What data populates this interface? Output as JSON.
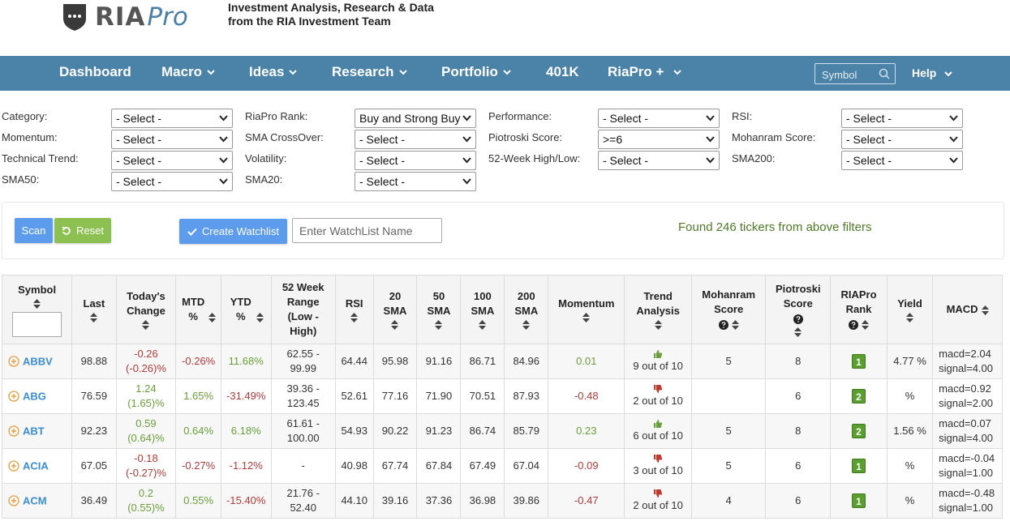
{
  "header": {
    "logo_ria": "RIA",
    "logo_pro": "Pro",
    "tagline_line1": "Investment Analysis, Research & Data",
    "tagline_line2": "from the RIA Investment Team"
  },
  "nav": {
    "items": [
      {
        "label": "Dashboard",
        "dropdown": false
      },
      {
        "label": "Macro",
        "dropdown": true
      },
      {
        "label": "Ideas",
        "dropdown": true
      },
      {
        "label": "Research",
        "dropdown": true
      },
      {
        "label": "Portfolio",
        "dropdown": true
      },
      {
        "label": "401K",
        "dropdown": false
      },
      {
        "label": "RiaPro +",
        "dropdown": true
      }
    ],
    "symbol_placeholder": "Symbol",
    "help_label": "Help"
  },
  "filters": {
    "category": {
      "label": "Category:",
      "value": "- Select -"
    },
    "momentum": {
      "label": "Momentum:",
      "value": "- Select -"
    },
    "technical_trend": {
      "label": "Technical Trend:",
      "value": "- Select -"
    },
    "sma50": {
      "label": "SMA50:",
      "value": "- Select -"
    },
    "riapro_rank": {
      "label": "RiaPro Rank:",
      "value": "Buy and Strong Buy"
    },
    "sma_crossover": {
      "label": "SMA CrossOver:",
      "value": "- Select -"
    },
    "volatility": {
      "label": "Volatility:",
      "value": "- Select -"
    },
    "sma20": {
      "label": "SMA20:",
      "value": "- Select -"
    },
    "performance": {
      "label": "Performance:",
      "value": "- Select -"
    },
    "piotroski": {
      "label": "Piotroski Score:",
      "value": ">=6"
    },
    "week52": {
      "label": "52-Week High/Low:",
      "value": "- Select -"
    },
    "rsi": {
      "label": "RSI:",
      "value": "- Select -"
    },
    "mohanram": {
      "label": "Mohanram Score:",
      "value": "- Select -"
    },
    "sma200": {
      "label": "SMA200:",
      "value": "- Select -"
    }
  },
  "actions": {
    "scan_label": "Scan",
    "reset_label": "Reset",
    "watchlist_label": "Create Watchlist",
    "watchlist_placeholder": "Enter WatchList Name",
    "found_text": "Found 246 tickers from above filters"
  },
  "table": {
    "headers": {
      "symbol": "Symbol",
      "last": "Last",
      "todays_change": "Today's Change",
      "mtd": "MTD %",
      "ytd": "YTD %",
      "week52": "52 Week Range (Low - High)",
      "rsi": "RSI",
      "sma20": "20 SMA",
      "sma50": "50 SMA",
      "sma100": "100 SMA",
      "sma200": "200 SMA",
      "momentum": "Momentum",
      "trend": "Trend Analysis",
      "mohanram": "Mohanram Score",
      "piotroski": "Piotroski Score",
      "rank": "RIAPro Rank",
      "yield": "Yield",
      "macd": "MACD"
    },
    "rows": [
      {
        "symbol": "ABBV",
        "last": "98.88",
        "chg1": "-0.26",
        "chg2": "(-0.26)%",
        "chg_dir": "neg",
        "mtd": "-0.26%",
        "mtd_dir": "neg",
        "ytd": "11.68%",
        "ytd_dir": "pos",
        "r1": "62.55 -",
        "r2": "99.99",
        "rsi": "64.44",
        "sma20": "95.98",
        "sma50": "91.16",
        "sma100": "86.71",
        "sma200": "84.96",
        "momentum": "0.01",
        "mom_dir": "pos",
        "trend_icon": "thumbs-up",
        "trend": "9 out of 10",
        "mohanram": "5",
        "piotroski": "8",
        "rank": "1",
        "yield": "4.77 %",
        "macd1": "macd=2.04",
        "macd2": "signal=4.00"
      },
      {
        "symbol": "ABG",
        "last": "76.59",
        "chg1": "1.24",
        "chg2": "(1.65)%",
        "chg_dir": "pos",
        "mtd": "1.65%",
        "mtd_dir": "pos",
        "ytd": "-31.49%",
        "ytd_dir": "neg",
        "r1": "39.36 -",
        "r2": "123.45",
        "rsi": "52.61",
        "sma20": "77.16",
        "sma50": "71.90",
        "sma100": "70.51",
        "sma200": "87.93",
        "momentum": "-0.48",
        "mom_dir": "neg",
        "trend_icon": "thumbs-down",
        "trend": "2 out of 10",
        "mohanram": "",
        "piotroski": "6",
        "rank": "2",
        "yield": "%",
        "macd1": "macd=0.92",
        "macd2": "signal=2.00"
      },
      {
        "symbol": "ABT",
        "last": "92.23",
        "chg1": "0.59",
        "chg2": "(0.64)%",
        "chg_dir": "pos",
        "mtd": "0.64%",
        "mtd_dir": "pos",
        "ytd": "6.18%",
        "ytd_dir": "pos",
        "r1": "61.61 -",
        "r2": "100.00",
        "rsi": "54.93",
        "sma20": "90.22",
        "sma50": "91.23",
        "sma100": "86.74",
        "sma200": "85.79",
        "momentum": "0.23",
        "mom_dir": "pos",
        "trend_icon": "thumbs-up",
        "trend": "6 out of 10",
        "mohanram": "5",
        "piotroski": "8",
        "rank": "2",
        "yield": "1.56 %",
        "macd1": "macd=0.07",
        "macd2": "signal=4.00"
      },
      {
        "symbol": "ACIA",
        "last": "67.05",
        "chg1": "-0.18",
        "chg2": "(-0.27)%",
        "chg_dir": "neg",
        "mtd": "-0.27%",
        "mtd_dir": "neg",
        "ytd": "-1.12%",
        "ytd_dir": "neg",
        "r1": "-",
        "r2": "",
        "rsi": "40.98",
        "sma20": "67.74",
        "sma50": "67.84",
        "sma100": "67.49",
        "sma200": "67.04",
        "momentum": "-0.09",
        "mom_dir": "neg",
        "trend_icon": "thumbs-down",
        "trend": "3 out of 10",
        "mohanram": "5",
        "piotroski": "6",
        "rank": "1",
        "yield": "%",
        "macd1": "macd=-0.04",
        "macd2": "signal=1.00"
      },
      {
        "symbol": "ACM",
        "last": "36.49",
        "chg1": "0.2",
        "chg2": "(0.55)%",
        "chg_dir": "pos",
        "mtd": "0.55%",
        "mtd_dir": "pos",
        "ytd": "-15.40%",
        "ytd_dir": "neg",
        "r1": "21.76 -",
        "r2": "52.40",
        "rsi": "44.10",
        "sma20": "39.16",
        "sma50": "37.36",
        "sma100": "36.98",
        "sma200": "39.86",
        "momentum": "-0.47",
        "mom_dir": "neg",
        "trend_icon": "thumbs-down",
        "trend": "2 out of 10",
        "mohanram": "4",
        "piotroski": "6",
        "rank": "1",
        "yield": "%",
        "macd1": "macd=-0.48",
        "macd2": "signal=1.00"
      }
    ]
  },
  "colors": {
    "nav_bg": "#4a82a8",
    "scan_btn": "#5d9cec",
    "reset_btn": "#8cc152",
    "negative": "#b23a3a",
    "positive": "#6a9e3a",
    "rank_badge": "#5a9e2f",
    "link": "#3a8dd0"
  }
}
